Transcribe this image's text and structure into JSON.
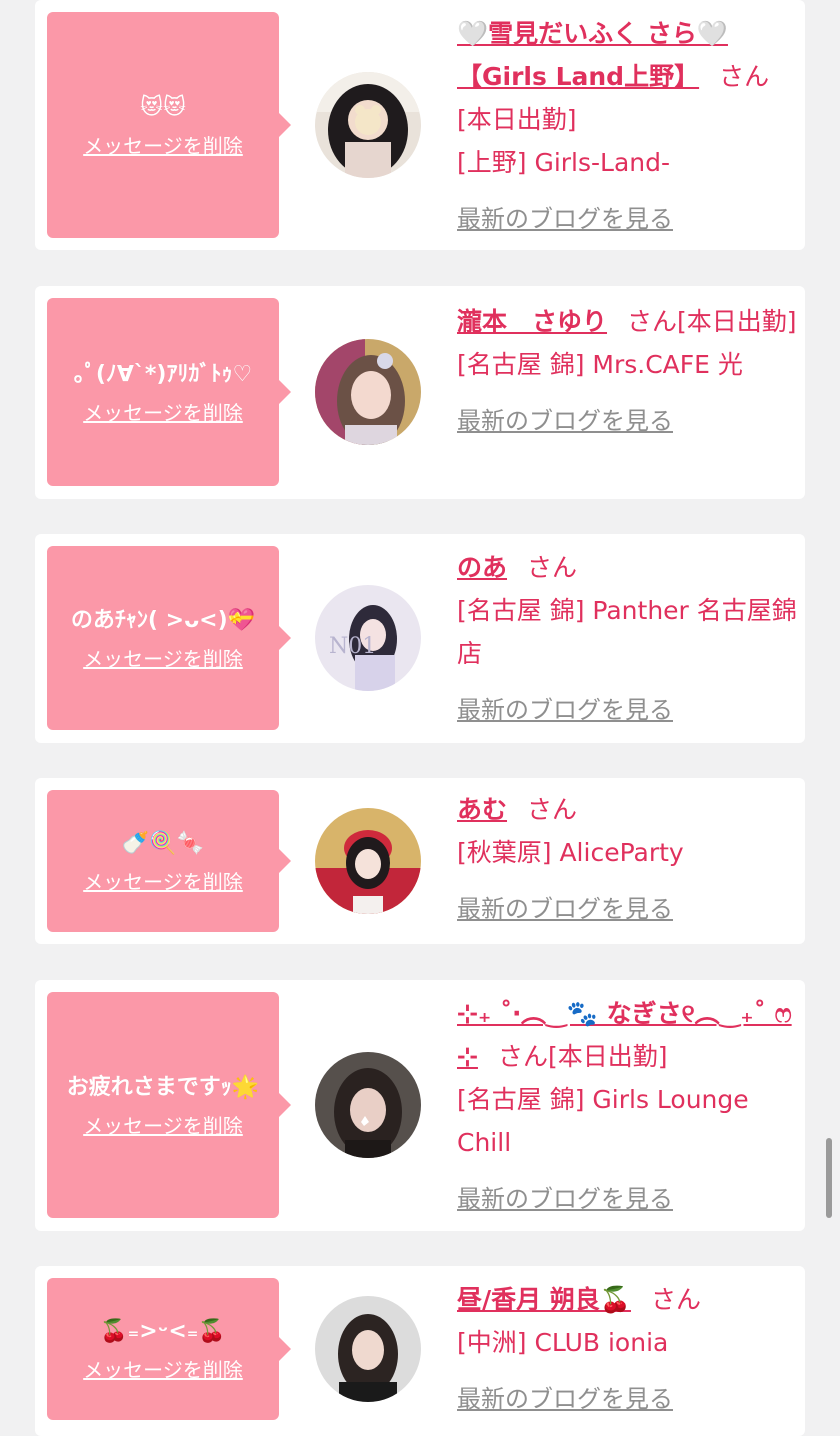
{
  "delete_label": "メッセージを削除",
  "san_label": "さん",
  "blog_label": "最新のブログを見る",
  "accent_color": "#e0305d",
  "bubble_color": "#fb98a8",
  "cards": [
    {
      "message": "😻😻",
      "name": "🤍雪見だいふく さら🤍【Girls Land上野】",
      "tail": "",
      "details": [
        "[本日出勤]",
        "[上野] Girls-Land-"
      ]
    },
    {
      "message": "｡ﾟ(ﾉ∀`*)ｱﾘｶﾞﾄｩ♡",
      "name": "瀧本　さゆり",
      "tail": "[本日出勤]",
      "details": [
        "[名古屋 錦] Mrs.CAFE 光"
      ]
    },
    {
      "message": "のあﾁｬﾝ( >ᴗ<)💝",
      "name": "のあ",
      "tail": "",
      "details": [
        "[名古屋 錦] Panther 名古屋錦店"
      ]
    },
    {
      "message": "🍼🍭🍬",
      "name": "あむ",
      "tail": "",
      "details": [
        "[秋葉原] AliceParty"
      ]
    },
    {
      "message": "お疲れさまですｯ🌟",
      "name": "⊹₊ ˚‧︵‿🐾 なぎさ୧︵‿₊˚ ෆ ⊹",
      "tail": "[本日出勤]",
      "details": [
        "[名古屋 錦] Girls Lounge Chill"
      ]
    },
    {
      "message": "🍒₌>ᵕ<₌🍒",
      "name": "昼/香月 朔良🍒",
      "tail": "",
      "details": [
        "[中洲] CLUB ionia"
      ]
    }
  ]
}
